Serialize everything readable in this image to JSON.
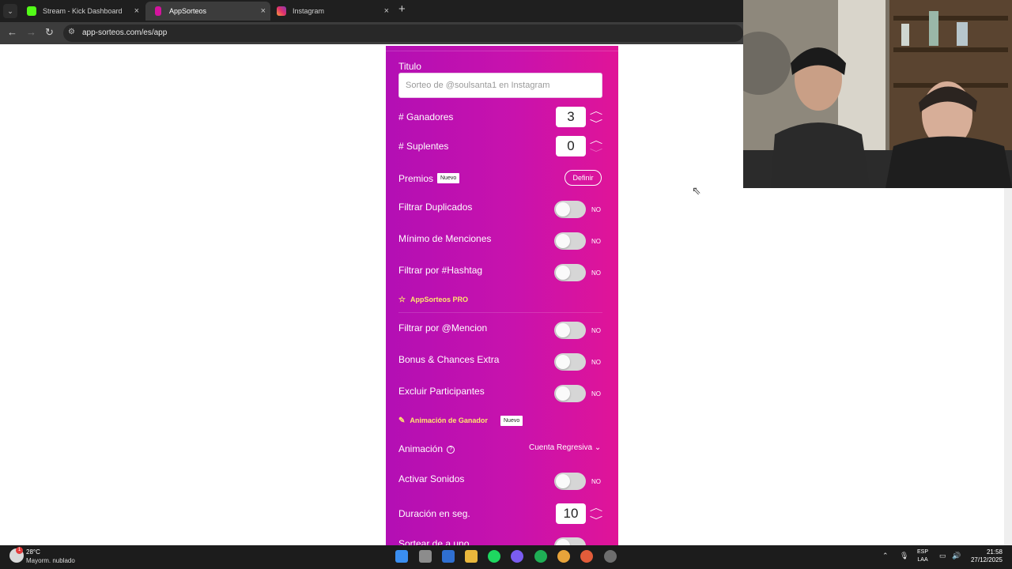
{
  "browser": {
    "tabs": [
      {
        "label": "Stream - Kick Dashboard",
        "icon": "kick-icon",
        "active": false
      },
      {
        "label": "AppSorteos",
        "icon": "appsorteos-icon",
        "active": true
      },
      {
        "label": "Instagram",
        "icon": "instagram-icon",
        "active": false
      }
    ],
    "close_glyph": "×",
    "new_tab_glyph": "+",
    "url": "app-sorteos.com/es/app"
  },
  "form": {
    "title_label": "Titulo",
    "title_placeholder": "Sorteo de @soulsanta1 en Instagram",
    "winners_label": "# Ganadores",
    "winners_value": "3",
    "substitutes_label": "# Suplentes",
    "substitutes_value": "0",
    "prizes_label": "Premios",
    "new_badge": "Nuevo",
    "define_button": "Definir",
    "filter_duplicates_label": "Filtrar Duplicados",
    "min_mentions_label": "Mínimo de Menciones",
    "filter_hashtag_label": "Filtrar por #Hashtag",
    "pro_section_title": "AppSorteos PRO",
    "filter_mention_label": "Filtrar por @Mencion",
    "bonus_label": "Bonus & Chances Extra",
    "exclude_label": "Excluir Participantes",
    "animation_section_title": "Animación de Ganador",
    "animation_label": "Animación",
    "animation_value": "Cuenta Regresiva",
    "sounds_label": "Activar Sonidos",
    "duration_label": "Duración en seg.",
    "duration_value": "10",
    "next_label": "Sortear de a uno",
    "toggle_off_text": "NO"
  },
  "colors": {
    "panel_start": "#b30fb4",
    "panel_end": "#e01498",
    "section_title": "#ffe66e"
  },
  "taskbar": {
    "temperature": "28°C",
    "condition": "Mayorm. nublado",
    "weather_badge": "1",
    "lang_line1": "ESP",
    "lang_line2": "LAA",
    "time": "21:58",
    "date": "27/12/2025"
  }
}
